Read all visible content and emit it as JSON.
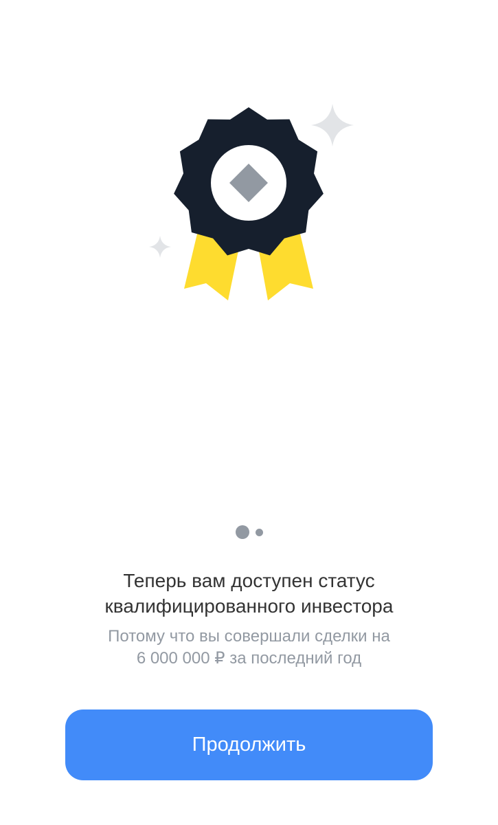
{
  "illustration": {
    "icon": "award-medal-icon",
    "colors": {
      "medal": "#161f2d",
      "ribbon": "#fedc2f",
      "inner_circle": "#ffffff",
      "diamond": "#9299a2",
      "sparkle": "#e2e4e7"
    }
  },
  "pager": {
    "total": 2,
    "active_index": 0
  },
  "onboarding": {
    "title_line1": "Теперь вам доступен статус",
    "title_line2": "квалифицированного инвестора",
    "subtitle_line1": "Потому что вы совершали сделки на",
    "subtitle_line2": "6 000 000 ₽ за последний год"
  },
  "actions": {
    "continue_label": "Продолжить",
    "continue_color": "#428bf9"
  }
}
